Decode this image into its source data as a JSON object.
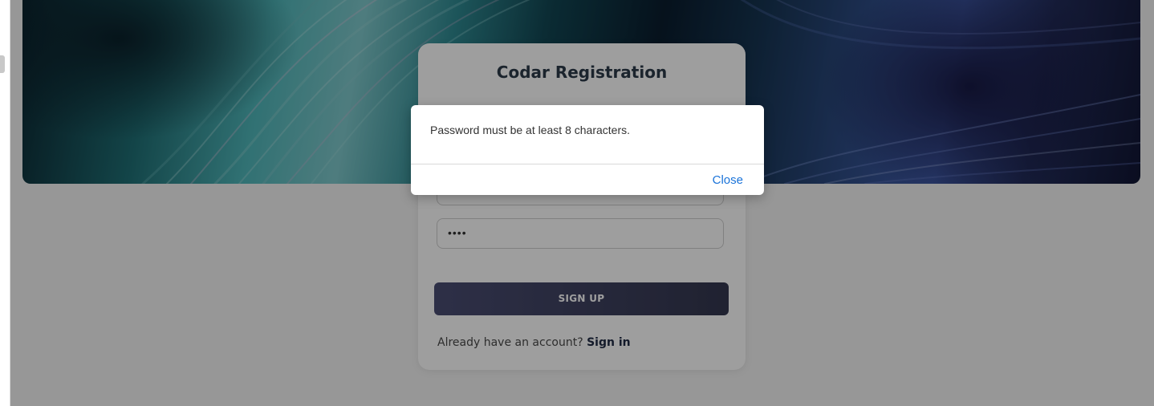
{
  "registration": {
    "title": "Codar Registration",
    "email_value": "",
    "password_value": "••••",
    "signup_label": "SIGN UP",
    "signin_prompt": "Already have an account?",
    "signin_link": "Sign in"
  },
  "dialog": {
    "message": "Password must be at least 8 characters.",
    "close_label": "Close"
  },
  "colors": {
    "accent": "#1a73d9",
    "button": "#3d405c",
    "overlay": "rgba(0,0,0,0.38)"
  }
}
